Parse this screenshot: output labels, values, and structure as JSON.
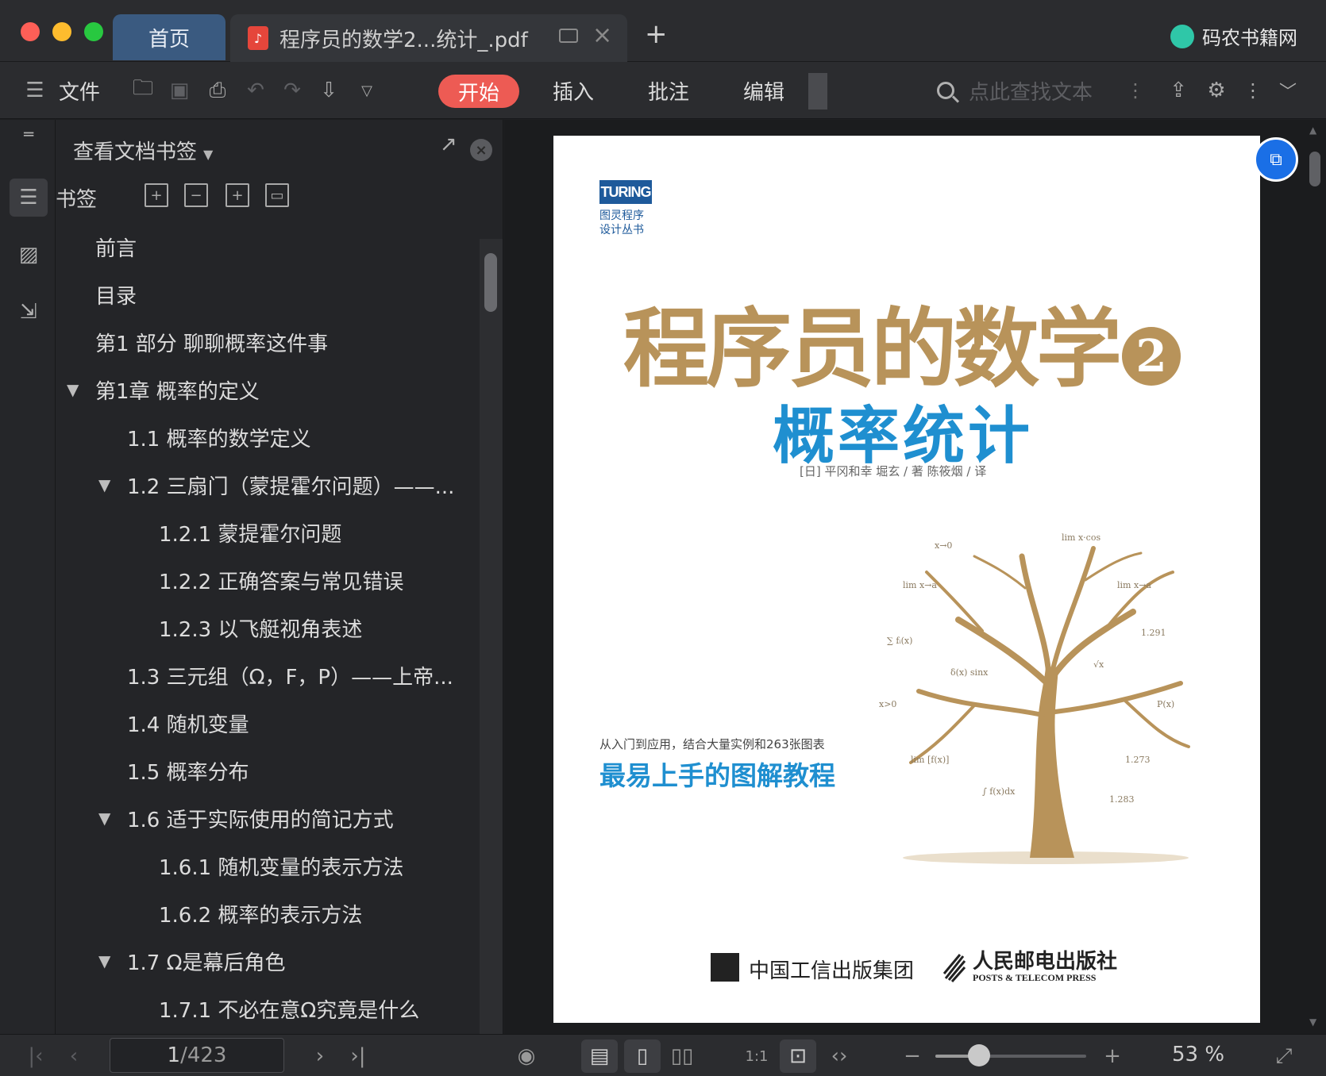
{
  "tabs": {
    "home": "首页",
    "document": "程序员的数学2...统计_.pdf",
    "brand": "码农书籍网"
  },
  "toolbar": {
    "file": "文件",
    "start": "开始",
    "insert": "插入",
    "annotate": "批注",
    "edit": "编辑",
    "search_placeholder": "点此查找文本"
  },
  "panel": {
    "title": "查看文档书签",
    "subtitle": "书签",
    "bookmarks": [
      {
        "label": "前言",
        "level": 1,
        "expanded": false
      },
      {
        "label": "目录",
        "level": 1,
        "expanded": false
      },
      {
        "label": "第1 部分  聊聊概率这件事",
        "level": 1,
        "expanded": false
      },
      {
        "label": "第1章  概率的定义",
        "level": 1,
        "expanded": true
      },
      {
        "label": "1.1  概率的数学定义",
        "level": 2,
        "expanded": false
      },
      {
        "label": "1.2  三扇门（蒙提霍尔问题）——...",
        "level": 2,
        "expanded": true
      },
      {
        "label": "1.2.1  蒙提霍尔问题",
        "level": 3,
        "expanded": false
      },
      {
        "label": "1.2.2  正确答案与常见错误",
        "level": 3,
        "expanded": false
      },
      {
        "label": "1.2.3  以飞艇视角表述",
        "level": 3,
        "expanded": false
      },
      {
        "label": "1.3  三元组（Ω，F，P）——上帝...",
        "level": 2,
        "expanded": false
      },
      {
        "label": "1.4  随机变量",
        "level": 2,
        "expanded": false
      },
      {
        "label": "1.5  概率分布",
        "level": 2,
        "expanded": false
      },
      {
        "label": "1.6  适于实际使用的简记方式",
        "level": 2,
        "expanded": true
      },
      {
        "label": "1.6.1  随机变量的表示方法",
        "level": 3,
        "expanded": false
      },
      {
        "label": "1.6.2  概率的表示方法",
        "level": 3,
        "expanded": false
      },
      {
        "label": "1.7  Ω是幕后角色",
        "level": 2,
        "expanded": true
      },
      {
        "label": "1.7.1  不必在意Ω究竟是什么",
        "level": 3,
        "expanded": false
      }
    ]
  },
  "cover": {
    "series_logo": "TURING",
    "series_line1": "图灵程序",
    "series_line2": "设计丛书",
    "title": "程序员的数学",
    "title_number": "2",
    "subtitle": "概率统计",
    "authors": "[日] 平冈和幸  堀玄 / 著    陈筱烟 / 译",
    "tag_small": "从入门到应用，结合大量实例和263张图表",
    "tagline": "最易上手的图解教程",
    "publisher1": "中国工信出版集团",
    "publisher2": "人民邮电出版社",
    "publisher2_en": "POSTS & TELECOM PRESS"
  },
  "status": {
    "current_page": "1",
    "total_pages": "/423",
    "zoom": "53 %",
    "zoom_fraction": 0.29
  },
  "colors": {
    "accent_start": "#ed5b54",
    "cover_gold": "#b8935a",
    "cover_blue": "#1f8fd0",
    "tab_home": "#3a5a80"
  }
}
